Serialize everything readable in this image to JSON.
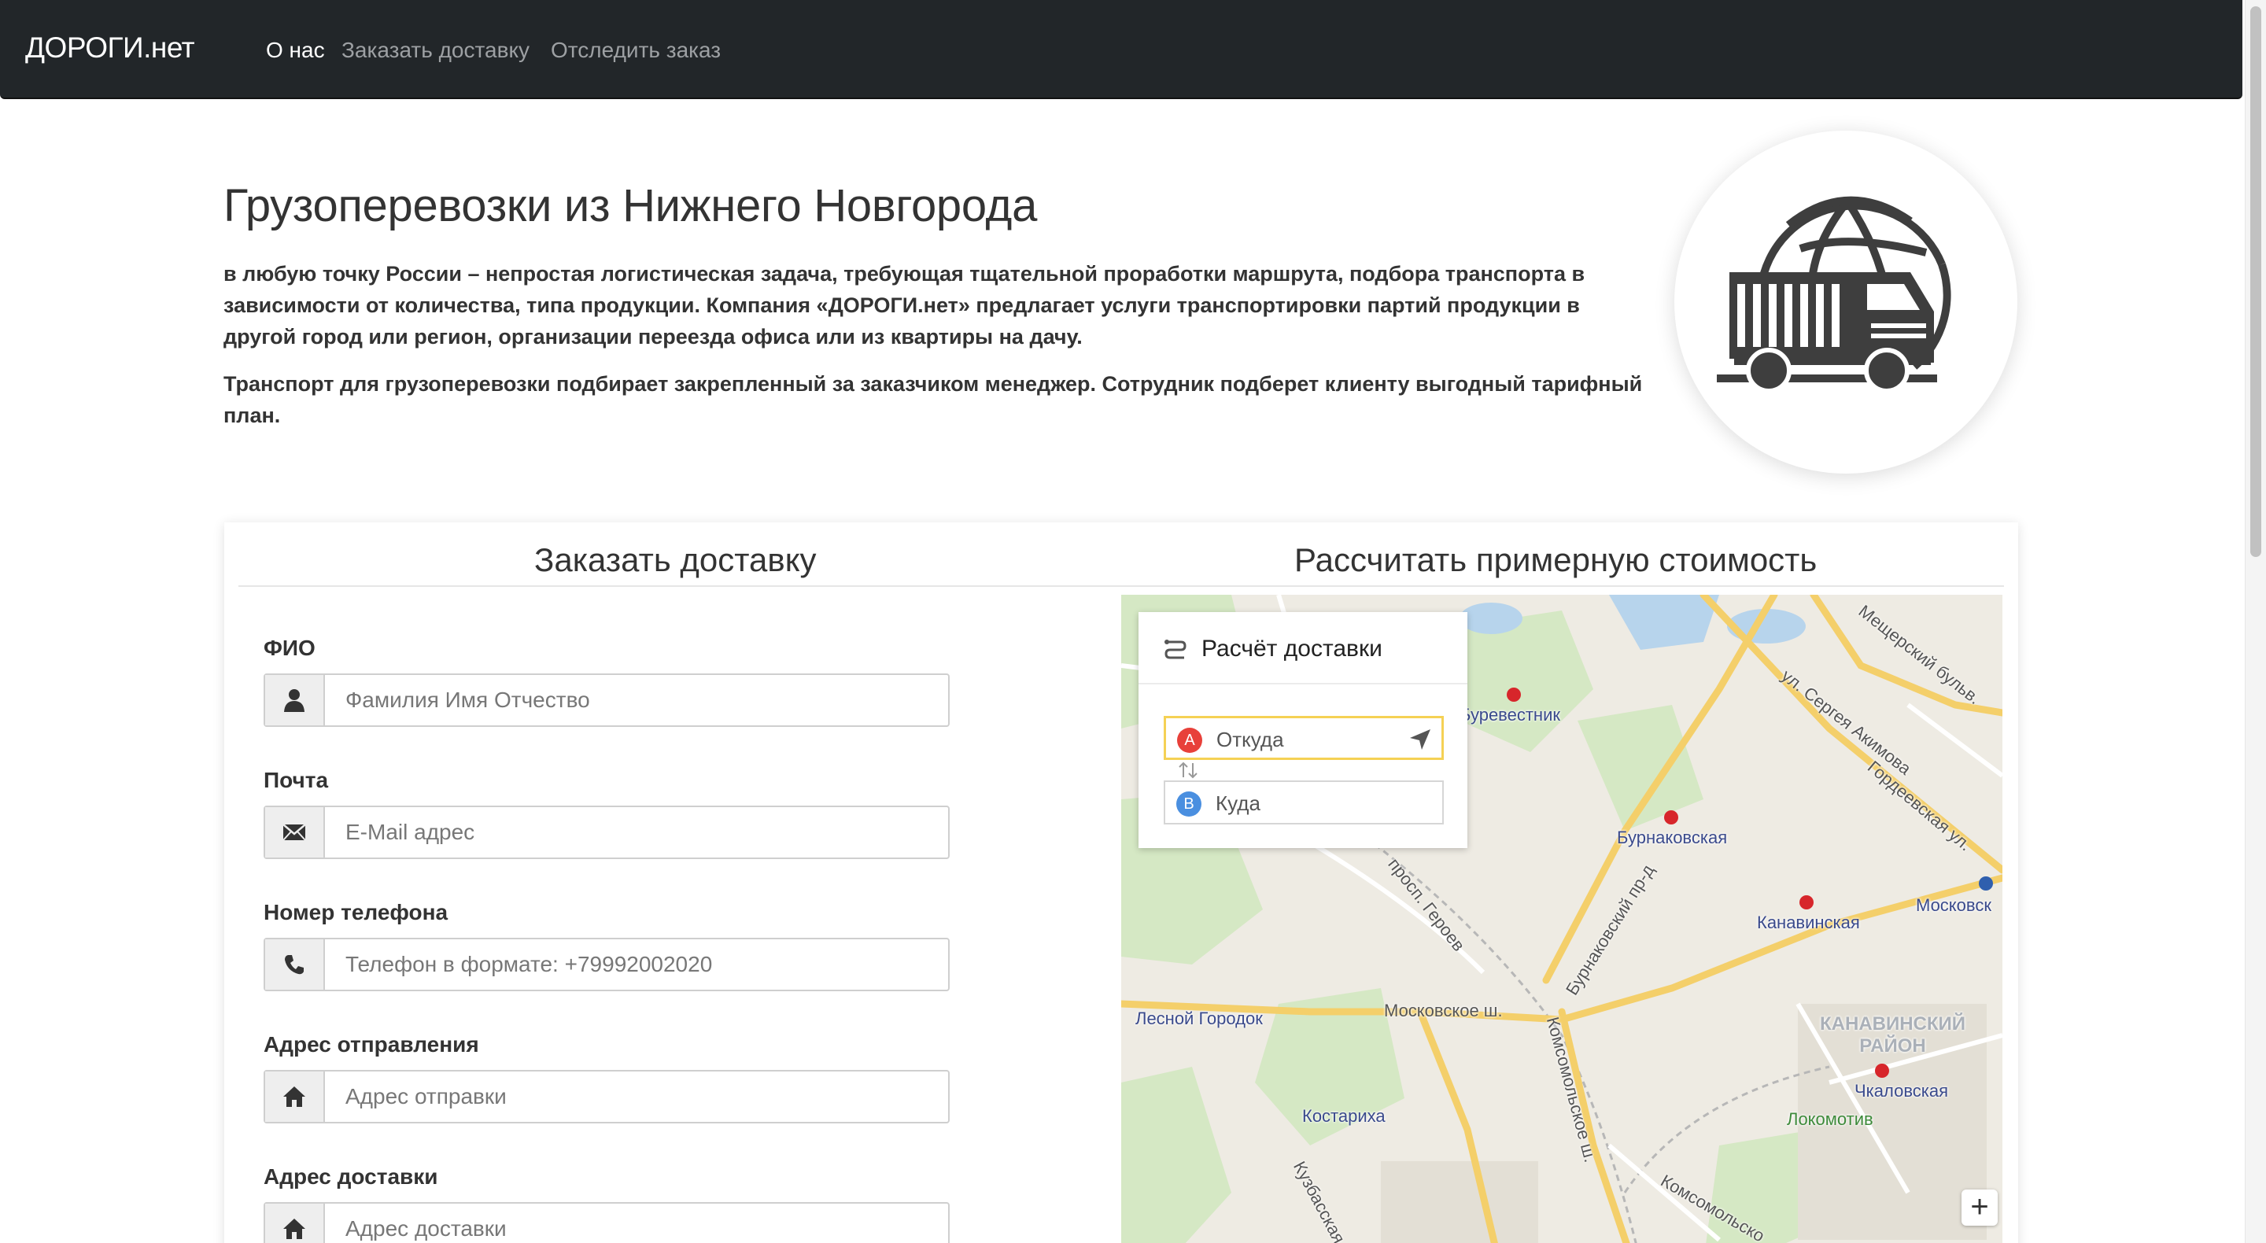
{
  "navbar": {
    "brand": "ДОРОГИ.нет",
    "links": [
      "О нас",
      "Заказать доставку",
      "Отследить заказ"
    ],
    "active_index": 0
  },
  "hero": {
    "title": "Грузоперевозки из Нижнего Новгорода",
    "paragraph1": "в любую точку России – непростая логистическая задача, требующая тщательной проработки маршрута, подбора транспорта в зависимости от количества, типа продукции. Компания «ДОРОГИ.нет» предлагает услуги транспортировки партий продукции в другой город или регион, организации переезда офиса или из квартиры на дачу.",
    "paragraph2": "Транспорт для грузоперевозки подбирает закрепленный за заказчиком менеджер. Сотрудник подберет клиенту выгодный тарифный план."
  },
  "order_form": {
    "heading": "Заказать доставку",
    "fields": [
      {
        "label": "ФИО",
        "placeholder": "Фамилия Имя Отчество",
        "icon": "user-icon"
      },
      {
        "label": "Почта",
        "placeholder": "E-Mail адрес",
        "icon": "envelope-icon"
      },
      {
        "label": "Номер телефона",
        "placeholder": "Телефон в формате: +79992002020",
        "icon": "phone-icon"
      },
      {
        "label": "Адрес отправления",
        "placeholder": "Адрес отправки",
        "icon": "home-icon"
      },
      {
        "label": "Адрес доставки",
        "placeholder": "Адрес доставки",
        "icon": "home-icon"
      }
    ]
  },
  "calculator": {
    "heading": "Рассчитать примерную стоимость",
    "route_panel": {
      "title": "Расчёт доставки",
      "from_badge": "A",
      "from_placeholder": "Откуда",
      "to_badge": "B",
      "to_placeholder": "Куда"
    },
    "map_labels": {
      "burevestnik": "Буревестник",
      "burnakovskaya": "Бурнаковская",
      "kanavinskaya": "Канавинская",
      "moskovsk": "Московск",
      "lesnoy_gorodok": "Лесной Городок",
      "moskovskoe_sh": "Московское ш.",
      "kostarikha": "Костариха",
      "chkalovskaya": "Чкаловская",
      "lokomotiv": "Локомотив",
      "district": "КАНАВИНСКИЙ\nРАЙОН",
      "akimova": "ул. Сергея Акимова",
      "prosp_geroev": "просп. Героев",
      "burnakovsky": "Бурнаковский пр-д",
      "komsomolskoe": "Комсомольское ш.",
      "kuzbasskaya": "Кузбасская",
      "komsomolsk2": "Комсомольско",
      "gordeevskaya": "Гордеевская ул.",
      "meshcherskiy": "Мещерский бульв.",
      "zoom_in": "+"
    },
    "colors": {
      "badge_a": "#e8403a",
      "badge_b": "#4a8fe0",
      "focus": "#f5d155"
    }
  }
}
